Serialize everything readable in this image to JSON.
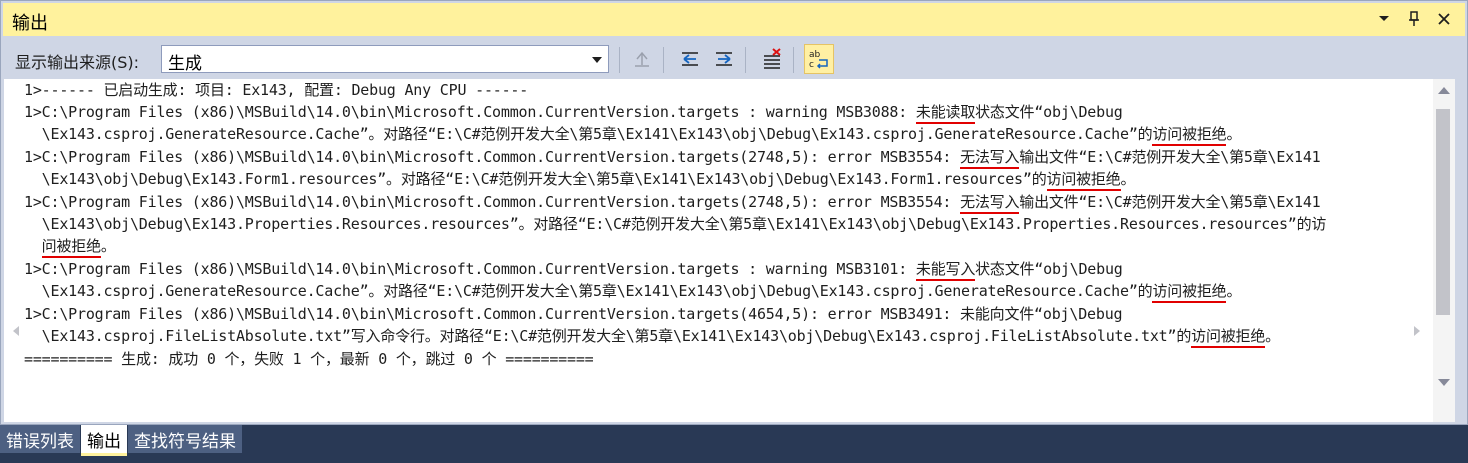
{
  "window": {
    "title": "输出",
    "controls": {
      "menu": "▾",
      "pin": "📌",
      "close": "✕"
    }
  },
  "toolbar": {
    "source_label": "显示输出来源(S):",
    "source_value": "生成",
    "icons": [
      "go-to-previous-icon",
      "align-left-icon",
      "align-right-icon",
      "clear-all-icon",
      "word-wrap-icon"
    ]
  },
  "output": {
    "lines": [
      "1>------ 已启动生成: 项目: Ex143, 配置: Debug Any CPU ------",
      "1>C:\\Program Files (x86)\\MSBuild\\14.0\\bin\\Microsoft.Common.CurrentVersion.targets : warning MSB3088: 未能读取状态文件“obj\\Debug",
      "  \\Ex143.csproj.GenerateResource.Cache”。对路径“E:\\C#范例开发大全\\第5章\\Ex141\\Ex143\\obj\\Debug\\Ex143.csproj.GenerateResource.Cache”的访问被拒绝。",
      "1>C:\\Program Files (x86)\\MSBuild\\14.0\\bin\\Microsoft.Common.CurrentVersion.targets(2748,5): error MSB3554: 无法写入输出文件“E:\\C#范例开发大全\\第5章\\Ex141",
      "  \\Ex143\\obj\\Debug\\Ex143.Form1.resources”。对路径“E:\\C#范例开发大全\\第5章\\Ex141\\Ex143\\obj\\Debug\\Ex143.Form1.resources”的访问被拒绝。",
      "1>C:\\Program Files (x86)\\MSBuild\\14.0\\bin\\Microsoft.Common.CurrentVersion.targets(2748,5): error MSB3554: 无法写入输出文件“E:\\C#范例开发大全\\第5章\\Ex141",
      "  \\Ex143\\obj\\Debug\\Ex143.Properties.Resources.resources”。对路径“E:\\C#范例开发大全\\第5章\\Ex141\\Ex143\\obj\\Debug\\Ex143.Properties.Resources.resources”的访",
      "  问被拒绝。",
      "1>C:\\Program Files (x86)\\MSBuild\\14.0\\bin\\Microsoft.Common.CurrentVersion.targets : warning MSB3101: 未能写入状态文件“obj\\Debug",
      "  \\Ex143.csproj.GenerateResource.Cache”。对路径“E:\\C#范例开发大全\\第5章\\Ex141\\Ex143\\obj\\Debug\\Ex143.csproj.GenerateResource.Cache”的访问被拒绝。",
      "1>C:\\Program Files (x86)\\MSBuild\\14.0\\bin\\Microsoft.Common.CurrentVersion.targets(4654,5): error MSB3491: 未能向文件“obj\\Debug",
      "  \\Ex143.csproj.FileListAbsolute.txt”写入命令行。对路径“E:\\C#范例开发大全\\第5章\\Ex141\\Ex143\\obj\\Debug\\Ex143.csproj.FileListAbsolute.txt”的访问被拒绝。",
      "========== 生成: 成功 0 个，失败 1 个，最新 0 个，跳过 0 个 =========="
    ],
    "highlight_color": "#e10000"
  },
  "tabs": [
    {
      "label": "错误列表",
      "active": false
    },
    {
      "label": "输出",
      "active": true
    },
    {
      "label": "查找符号结果",
      "active": false
    }
  ]
}
